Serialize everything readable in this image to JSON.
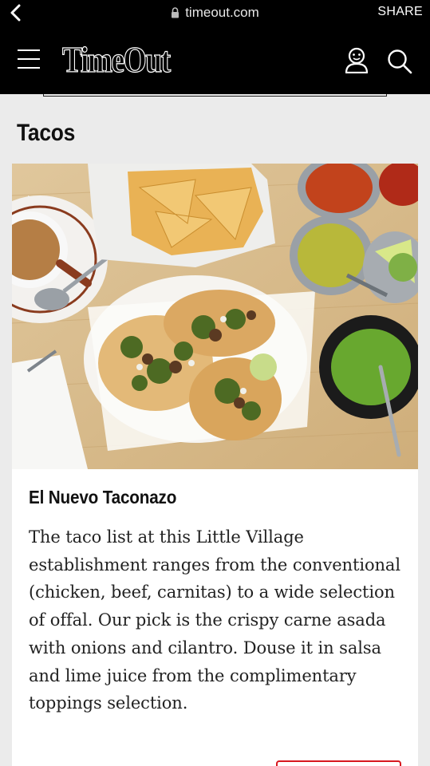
{
  "browser": {
    "url": "timeout.com",
    "share_label": "SHARE"
  },
  "header": {
    "logo_text": "TimeOut"
  },
  "section": {
    "title": "Tacos"
  },
  "card": {
    "title": "El Nuevo Taconazo",
    "body": "The taco list at this Little Village establishment ranges from the conventional (chicken, beef, carnitas) to a wide selection of offal. Our pick is the crispy carne asada with onions and cilantro. Douse it in salsa and lime juice from the complimentary toppings selection."
  },
  "colors": {
    "header_bg": "#000000",
    "page_bg": "#ebebeb",
    "accent": "#d71920"
  },
  "icons": [
    "back-chevron-icon",
    "lock-icon",
    "hamburger-menu-icon",
    "user-icon",
    "search-icon"
  ]
}
